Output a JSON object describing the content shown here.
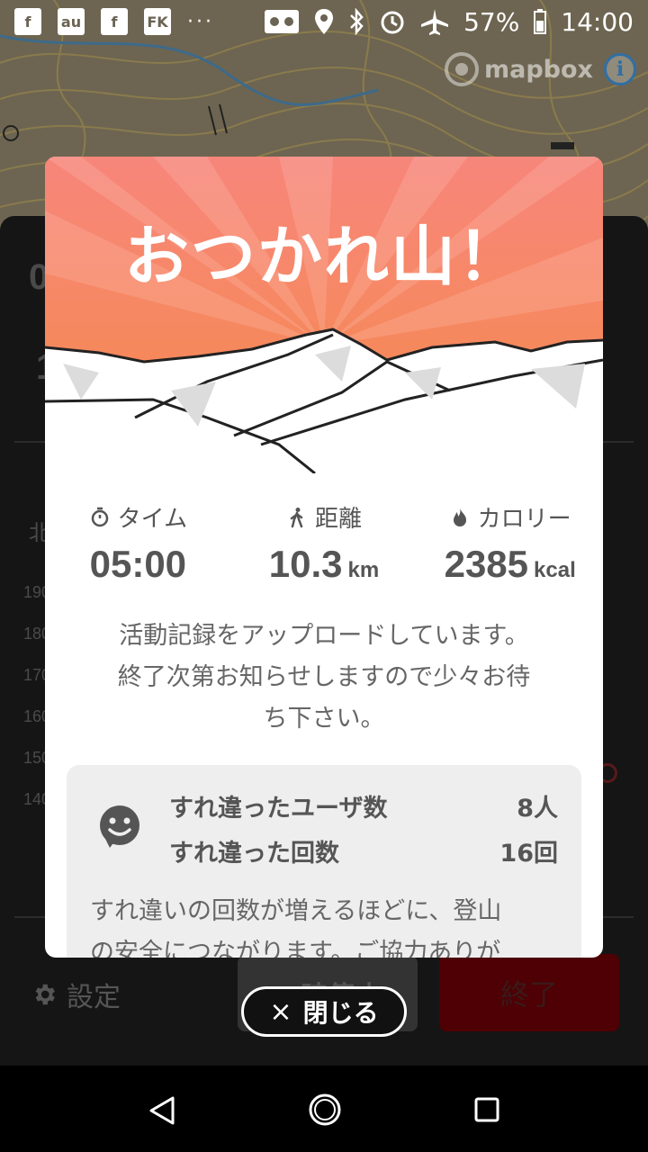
{
  "status_bar": {
    "left_icons": [
      "facebook-icon",
      "au-icon",
      "facebook-icon",
      "fk-icon"
    ],
    "more": "···",
    "battery": "57%",
    "time": "14:00"
  },
  "map": {
    "attribution": "mapbox",
    "info": "i"
  },
  "background_panel": {
    "partial_text": [
      "0",
      "1",
      "北",
      "190",
      "180",
      "170",
      "160",
      "150",
      "140"
    ],
    "settings_label": "設定",
    "pause_label": "一時停止",
    "end_label": "終了"
  },
  "modal": {
    "title": "おつかれ山！",
    "stats": [
      {
        "label": "タイム",
        "value": "05:00",
        "unit": "",
        "icon": "stopwatch-icon"
      },
      {
        "label": "距離",
        "value": "10.3",
        "unit": "km",
        "icon": "hiker-icon"
      },
      {
        "label": "カロリー",
        "value": "2385",
        "unit": "kcal",
        "icon": "flame-icon"
      }
    ],
    "message_lines": [
      "活動記録をアップロードしています。",
      "終了次第お知らせしますので少々お待",
      "ち下さい。"
    ],
    "encounters": {
      "users_label": "すれ違ったユーザ数",
      "users_value": "8人",
      "count_label": "すれ違った回数",
      "count_value": "16回",
      "note_lines": [
        "すれ違いの回数が増えるほどに、登山",
        "の安全につながります。ご協力ありが"
      ]
    }
  },
  "close_button": {
    "label": "閉じる",
    "icon": "×"
  },
  "colors": {
    "accent_red": "#e34a4a",
    "end_button": "#4e0004",
    "hero_top": "#f7867b",
    "hero_bottom": "#f68a4a"
  }
}
